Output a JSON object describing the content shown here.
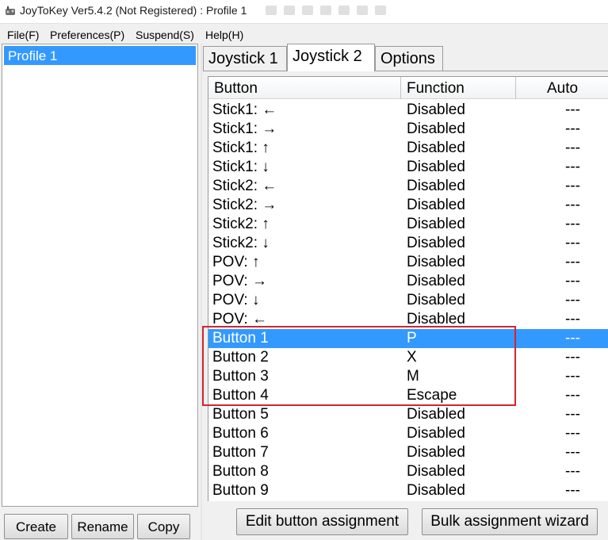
{
  "window": {
    "title": "JoyToKey Ver5.4.2 (Not Registered) : Profile 1"
  },
  "menu": [
    "File(F)",
    "Preferences(P)",
    "Suspend(S)",
    "Help(H)"
  ],
  "profiles": {
    "items": [
      "Profile 1"
    ],
    "selected": "Profile 1",
    "buttons": {
      "create": "Create",
      "rename": "Rename",
      "copy": "Copy"
    }
  },
  "tabs": {
    "items": [
      "Joystick 1",
      "Joystick 2",
      "Options"
    ],
    "active": "Joystick 2"
  },
  "table": {
    "columns": [
      "Button",
      "Function",
      "Auto"
    ],
    "rows": [
      {
        "button": "Stick1: ←",
        "function": "Disabled",
        "auto": "---"
      },
      {
        "button": "Stick1: →",
        "function": "Disabled",
        "auto": "---"
      },
      {
        "button": "Stick1: ↑",
        "function": "Disabled",
        "auto": "---"
      },
      {
        "button": "Stick1: ↓",
        "function": "Disabled",
        "auto": "---"
      },
      {
        "button": "Stick2: ←",
        "function": "Disabled",
        "auto": "---"
      },
      {
        "button": "Stick2: →",
        "function": "Disabled",
        "auto": "---"
      },
      {
        "button": "Stick2: ↑",
        "function": "Disabled",
        "auto": "---"
      },
      {
        "button": "Stick2: ↓",
        "function": "Disabled",
        "auto": "---"
      },
      {
        "button": "POV: ↑",
        "function": "Disabled",
        "auto": "---"
      },
      {
        "button": "POV: →",
        "function": "Disabled",
        "auto": "---"
      },
      {
        "button": "POV: ↓",
        "function": "Disabled",
        "auto": "---"
      },
      {
        "button": "POV: ←",
        "function": "Disabled",
        "auto": "---"
      },
      {
        "button": "Button 1",
        "function": "P",
        "auto": "---"
      },
      {
        "button": "Button 2",
        "function": "X",
        "auto": "---"
      },
      {
        "button": "Button 3",
        "function": "M",
        "auto": "---"
      },
      {
        "button": "Button 4",
        "function": "Escape",
        "auto": "---"
      },
      {
        "button": "Button 5",
        "function": "Disabled",
        "auto": "---"
      },
      {
        "button": "Button 6",
        "function": "Disabled",
        "auto": "---"
      },
      {
        "button": "Button 7",
        "function": "Disabled",
        "auto": "---"
      },
      {
        "button": "Button 8",
        "function": "Disabled",
        "auto": "---"
      },
      {
        "button": "Button 9",
        "function": "Disabled",
        "auto": "---"
      }
    ],
    "selected_row": "Button 1"
  },
  "actions": {
    "edit": "Edit button assignment",
    "bulk": "Bulk assignment wizard"
  },
  "colors": {
    "selection": "#3399ff",
    "highlight_box": "#d4242e"
  }
}
